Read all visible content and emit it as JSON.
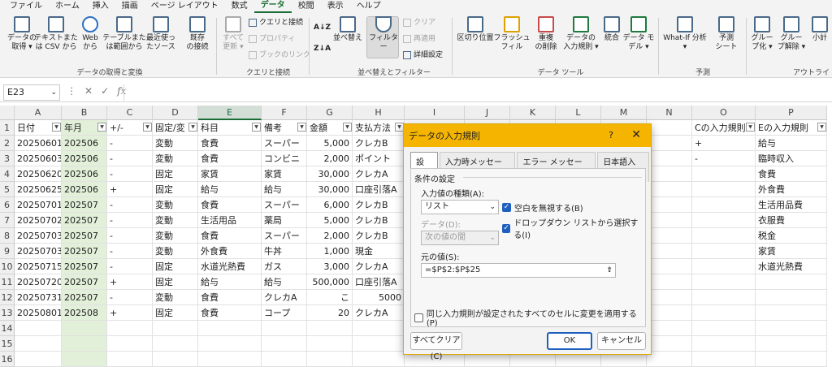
{
  "menu": [
    "ファイル",
    "ホーム",
    "挿入",
    "描画",
    "ページ レイアウト",
    "数式",
    "データ",
    "校閲",
    "表示",
    "ヘルプ"
  ],
  "ribbon": {
    "get_transform": {
      "label": "データの取得と変換",
      "buttons": [
        "データの\n取得 ▾",
        "テキストまた\nは CSV から",
        "Web\nから",
        "テーブルまた\nは範囲から",
        "最近使っ\nたソース",
        "既存\nの接続"
      ]
    },
    "queries": {
      "label": "クエリと接続",
      "refresh": "すべて\n更新 ▾",
      "items": [
        "クエリと接続",
        "プロパティ",
        "ブックのリンク"
      ]
    },
    "sort_filter": {
      "label": "並べ替えとフィルター",
      "sort": "並べ替え",
      "filter": "フィルター",
      "items": [
        "クリア",
        "再適用",
        "詳細設定"
      ]
    },
    "data_tools": {
      "label": "データ ツール",
      "buttons": [
        "区切り位置",
        "フラッシュ\nフィル",
        "重複\nの削除",
        "データの\n入力規則 ▾",
        "統合",
        "データ モ\nデル ▾"
      ]
    },
    "forecast": {
      "label": "予測",
      "buttons": [
        "What-If 分析\n▾",
        "予測\nシート"
      ]
    },
    "outline": {
      "label": "アウトライ",
      "buttons": [
        "グルー\nプ化 ▾",
        "グルー\nプ解除 ▾",
        "小計"
      ]
    }
  },
  "formula_bar": {
    "name_box": "E23",
    "fx": "fx"
  },
  "columns": [
    "A",
    "B",
    "C",
    "D",
    "E",
    "F",
    "G",
    "H",
    "I",
    "J",
    "K",
    "L",
    "M",
    "N",
    "O",
    "P"
  ],
  "rows": [
    "1",
    "2",
    "3",
    "4",
    "5",
    "6",
    "7",
    "8",
    "9",
    "10",
    "11",
    "12",
    "13",
    "14",
    "15",
    "16"
  ],
  "headers": {
    "A": "日付",
    "B": "年月",
    "C": "+/-",
    "D": "固定/変",
    "E": "科目",
    "F": "備考",
    "G": "金額",
    "H": "支払方法",
    "O": "Cの入力規則",
    "P": "Eの入力規則"
  },
  "table": [
    [
      "20250601",
      "202506",
      "-",
      "変動",
      "食費",
      "スーパー",
      "5,000",
      "クレカB"
    ],
    [
      "20250603",
      "202506",
      "-",
      "変動",
      "食費",
      "コンビニ",
      "2,000",
      "ポイント"
    ],
    [
      "20250620",
      "202506",
      "-",
      "固定",
      "家賃",
      "家賃",
      "30,000",
      "クレカA"
    ],
    [
      "20250625",
      "202506",
      "+",
      "固定",
      "給与",
      "給与",
      "30,000",
      "口座引落A"
    ],
    [
      "20250701",
      "202507",
      "-",
      "変動",
      "食費",
      "スーパー",
      "6,000",
      "クレカB"
    ],
    [
      "20250702",
      "202507",
      "-",
      "変動",
      "生活用品",
      "薬局",
      "5,000",
      "クレカB"
    ],
    [
      "20250703",
      "202507",
      "-",
      "変動",
      "食費",
      "スーパー",
      "2,000",
      "クレカB"
    ],
    [
      "20250703",
      "202507",
      "-",
      "変動",
      "外食費",
      "牛丼",
      "1,000",
      "現金"
    ],
    [
      "20250715",
      "202507",
      "-",
      "固定",
      "水道光熱費",
      "ガス",
      "3,000",
      "クレカA"
    ],
    [
      "20250720",
      "202507",
      "+",
      "固定",
      "給与",
      "給与",
      "500,000",
      "口座引落A"
    ],
    [
      "20250731",
      "202507",
      "-",
      "変動",
      "食費",
      "クレカA",
      "こ",
      "5000"
    ],
    [
      "20250801",
      "202508",
      "+",
      "固定",
      "食費",
      "コープ",
      "20",
      "クレカA"
    ]
  ],
  "col_o": [
    "+",
    "-"
  ],
  "col_p": [
    "給与",
    "臨時収入",
    "食費",
    "外食費",
    "生活用品費",
    "衣服費",
    "税金",
    "家賃",
    "水道光熱費"
  ],
  "dialog": {
    "title": "データの入力規則",
    "help": "?",
    "close": "✕",
    "tabs": [
      "設定",
      "入力時メッセージ",
      "エラー メッセージ",
      "日本語入力"
    ],
    "section": "条件の設定",
    "type_label": "入力値の種類(A):",
    "type_value": "リスト",
    "data_label": "データ(D):",
    "data_value": "次の値の間",
    "ignore_blank": "空白を無視する(B)",
    "dropdown": "ドロップダウン リストから選択する(I)",
    "source_label": "元の値(S):",
    "source_value": "=$P$2:$P$25",
    "apply_all": "同じ入力規則が設定されたすべてのセルに変更を適用する(P)",
    "clear_btn": "すべてクリア(C)",
    "ok_btn": "OK",
    "cancel_btn": "キャンセル"
  }
}
